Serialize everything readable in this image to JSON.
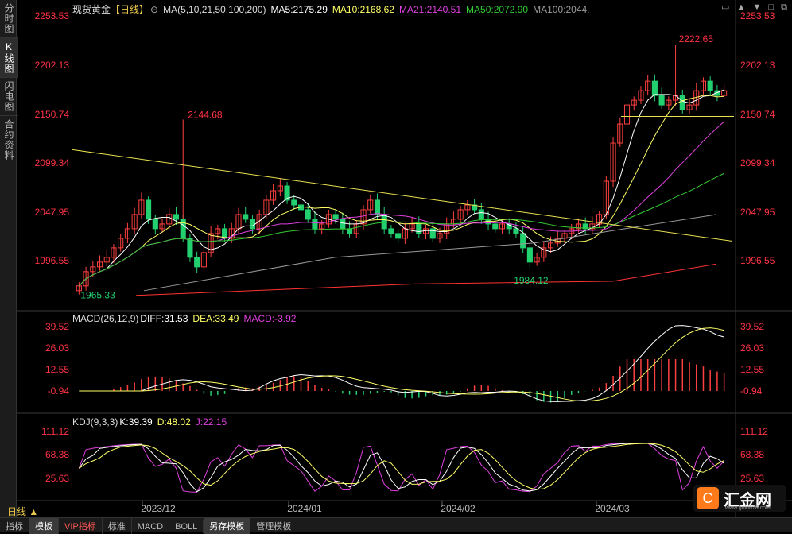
{
  "sidebar": {
    "tabs": [
      "分时图",
      "K线图",
      "闪电图",
      "合约资料"
    ],
    "active": 1
  },
  "header": {
    "symbol": "现货黄金",
    "period": "【日线】",
    "settings_glyph": "⊖",
    "ma_params": "MA(5,10,21,50,100,200)",
    "ma5": "MA5:2175.29",
    "ma10": "MA10:2168.62",
    "ma21": "MA21:2140.51",
    "ma50": "MA50:2072.90",
    "ma100": "MA100:2044."
  },
  "macd_legend": {
    "params": "MACD(26,12,9)",
    "diff": "DIFF:31.53",
    "dea": "DEA:33.49",
    "macd": "MACD:-3.92"
  },
  "kdj_legend": {
    "params": "KDJ(9,3,3)",
    "k": "K:39.39",
    "d": "D:48.02",
    "j": "J:22.15"
  },
  "price_axis": [
    "2253.53",
    "2202.13",
    "2150.74",
    "2099.34",
    "2047.95",
    "1996.55"
  ],
  "macd_axis": [
    "39.52",
    "26.03",
    "12.55",
    "-0.94"
  ],
  "kdj_axis": [
    "111.12",
    "68.38",
    "25.63"
  ],
  "annotations": {
    "high_all": "2222.65",
    "high_dec": "2144.68",
    "low_feb": "1984.12",
    "low_nov": "1965.33"
  },
  "date_labels": [
    "2023/12",
    "2024/01",
    "2024/02",
    "2024/03"
  ],
  "period_label": "日线 ▲",
  "bottom_tabs": [
    "指标",
    "模板",
    "VIP指标",
    "标准",
    "MACD",
    "BOLL",
    "另存模板",
    "管理模板"
  ],
  "logo": {
    "glyph": "C",
    "name": "汇金网",
    "url": "www.gold678.com"
  },
  "colors": {
    "up": "#ff4040",
    "down": "#22d070",
    "ma5": "#ffffff",
    "ma10": "#ffff66",
    "ma21": "#e040e0",
    "ma50": "#33cc33",
    "ma100": "#999999",
    "ma200": "#ff3333",
    "label": "#ff3344",
    "trend": "#e8e050"
  }
}
